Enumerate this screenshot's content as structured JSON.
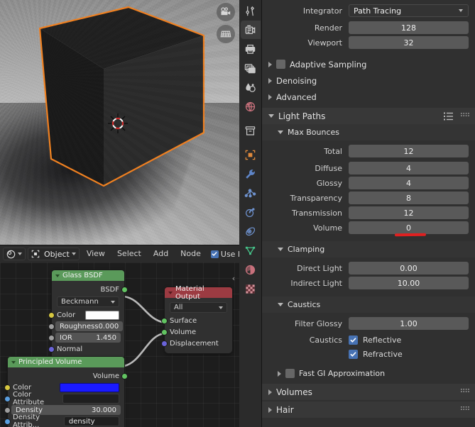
{
  "viewport": {
    "name": "3d-viewport",
    "object": "Cube",
    "outline_color": "#f08020",
    "gizmos": [
      {
        "name": "camera-view-icon",
        "label": "Camera View"
      },
      {
        "name": "toggle-xray-grid-icon",
        "label": "Toggle Grid"
      }
    ]
  },
  "node_editor": {
    "header": {
      "editor_type": "Shader Editor",
      "shader_type": "Object",
      "menus": [
        "View",
        "Select",
        "Add",
        "Node"
      ],
      "use_nodes_label": "Use N",
      "use_nodes_checked": true
    },
    "sidebar_arrow": "‹",
    "nodes": [
      {
        "name": "glass-bsdf-node",
        "title": "Glass BSDF",
        "header_color": "#5a9a5a",
        "outputs": [
          {
            "label": "BSDF",
            "socket": "green"
          }
        ],
        "distribution": "Beckmann",
        "inputs": [
          {
            "label": "Color",
            "socket": "yellow",
            "type": "swatch",
            "value": "#ffffff"
          },
          {
            "label": "Roughness",
            "socket": "grey",
            "type": "value",
            "value": "0.000"
          },
          {
            "label": "IOR",
            "socket": "grey",
            "type": "value",
            "value": "1.450"
          },
          {
            "label": "Normal",
            "socket": "purple",
            "type": "plain",
            "value": ""
          }
        ]
      },
      {
        "name": "principled-volume-node",
        "title": "Principled Volume",
        "header_color": "#5a9a5a",
        "outputs": [
          {
            "label": "Volume",
            "socket": "green"
          }
        ],
        "inputs": [
          {
            "label": "Color",
            "socket": "yellow",
            "type": "swatch",
            "value": "#1a1aff"
          },
          {
            "label": "Color Attribute",
            "socket": "blue",
            "type": "text",
            "value": ""
          },
          {
            "label": "Density",
            "socket": "grey",
            "type": "value",
            "value": "30.000"
          },
          {
            "label": "Density Attrib...",
            "socket": "blue",
            "type": "text",
            "value": "density"
          }
        ]
      },
      {
        "name": "material-output-node",
        "title": "Material Output",
        "header_color": "#9c3b42",
        "target": "All",
        "inputs": [
          {
            "label": "Surface",
            "socket": "green"
          },
          {
            "label": "Volume",
            "socket": "green"
          },
          {
            "label": "Displacement",
            "socket": "purple"
          }
        ]
      }
    ]
  },
  "properties": {
    "tabs": [
      {
        "name": "tool-tab",
        "icon": "tool-icon",
        "selected": false
      },
      {
        "name": "render-tab",
        "icon": "camera-back-icon",
        "selected": true
      },
      {
        "name": "output-tab",
        "icon": "printer-icon",
        "selected": false
      },
      {
        "name": "view-layer-tab",
        "icon": "images-icon",
        "selected": false
      },
      {
        "name": "scene-tab",
        "icon": "cone-droplet-icon",
        "selected": false
      },
      {
        "name": "world-tab",
        "icon": "globe-icon",
        "selected": false
      },
      {
        "name": "collection-tab",
        "icon": "box-icon",
        "selected": false
      },
      {
        "name": "object-tab",
        "icon": "orange-square-icon",
        "selected": false
      },
      {
        "name": "modifier-tab",
        "icon": "wrench-icon",
        "selected": false
      },
      {
        "name": "particles-tab",
        "icon": "particles-icon",
        "selected": false
      },
      {
        "name": "physics-tab",
        "icon": "physics-orbit-icon",
        "selected": false
      },
      {
        "name": "constraints-tab",
        "icon": "constraint-icon",
        "selected": false
      },
      {
        "name": "data-tab",
        "icon": "green-triangle-mesh-icon",
        "selected": false
      },
      {
        "name": "material-tab",
        "icon": "material-sphere-icon",
        "selected": false
      },
      {
        "name": "texture-tab",
        "icon": "checker-texture-icon",
        "selected": false
      }
    ],
    "sampling": {
      "integrator_label": "Integrator",
      "integrator_value": "Path Tracing",
      "render_label": "Render",
      "render_value": "128",
      "viewport_label": "Viewport",
      "viewport_value": "32",
      "adaptive_sampling_label": "Adaptive Sampling",
      "adaptive_sampling_checked": false,
      "denoising_label": "Denoising",
      "advanced_label": "Advanced"
    },
    "light_paths": {
      "title": "Light Paths",
      "max_bounces_title": "Max Bounces",
      "max_bounces": [
        {
          "label": "Total",
          "value": "12"
        },
        {
          "label": "Diffuse",
          "value": "4"
        },
        {
          "label": "Glossy",
          "value": "4"
        },
        {
          "label": "Transparency",
          "value": "8"
        },
        {
          "label": "Transmission",
          "value": "12"
        },
        {
          "label": "Volume",
          "value": "0",
          "annotated": true
        }
      ],
      "clamping_title": "Clamping",
      "clamping": [
        {
          "label": "Direct Light",
          "value": "0.00"
        },
        {
          "label": "Indirect Light",
          "value": "10.00"
        }
      ],
      "caustics_title": "Caustics",
      "filter_glossy_label": "Filter Glossy",
      "filter_glossy_value": "1.00",
      "caustics_label": "Caustics",
      "reflective_label": "Reflective",
      "reflective_checked": true,
      "refractive_label": "Refractive",
      "refractive_checked": true,
      "fast_gi_label": "Fast GI Approximation",
      "fast_gi_checked": false
    },
    "volumes_label": "Volumes",
    "hair_label": "Hair",
    "annotation_color": "#e02020"
  }
}
